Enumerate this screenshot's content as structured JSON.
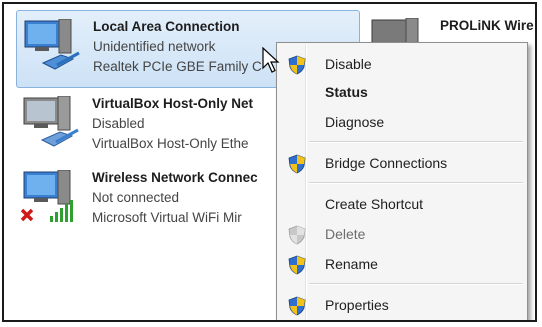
{
  "connections": [
    {
      "name": "Local Area Connection",
      "status": "Unidentified network",
      "adapter": "Realtek PCIe GBE Family C",
      "icon": "wired-network-icon"
    },
    {
      "name": "VirtualBox Host-Only Net",
      "status": "Disabled",
      "adapter": "VirtualBox Host-Only Ethe",
      "icon": "wired-network-icon"
    },
    {
      "name": "Wireless Network Connec",
      "status": "Not connected",
      "adapter": "Microsoft Virtual WiFi Mir",
      "icon": "wireless-network-icon"
    },
    {
      "name": "PROLiNK Wire",
      "status": "",
      "adapter": "",
      "icon": "wireless-network-icon"
    }
  ],
  "menu": {
    "disable": "Disable",
    "status": "Status",
    "diagnose": "Diagnose",
    "bridge": "Bridge Connections",
    "shortcut": "Create Shortcut",
    "delete": "Delete",
    "rename": "Rename",
    "properties": "Properties"
  },
  "colors": {
    "selection": "#cde2f6",
    "shield_blue": "#2f6fd0",
    "shield_yellow": "#f3c21a"
  }
}
